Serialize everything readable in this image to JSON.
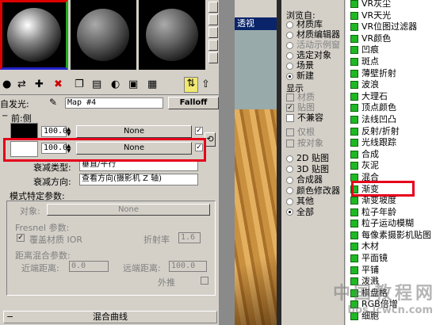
{
  "viewport_tab": "透视",
  "self_illum_label": "自发光:",
  "map_name": "Map #4",
  "falloff_label": "Falloff",
  "section_front_side": "前:侧",
  "front_value": "100.0",
  "front_map": "None",
  "side_value": "100.0",
  "side_map": "None",
  "falloff_type_label": "衰减类型:",
  "falloff_type_value": "垂直/平行",
  "falloff_dir_label": "衰减方向:",
  "falloff_dir_value": "查看方向(摄影机 Z 轴)",
  "mode_params_title": "模式特定参数:",
  "object_label": "对象:",
  "object_value": "None",
  "fresnel_label": "Fresnel 参数:",
  "override_ior_label": "覆盖材质 IOR",
  "ior_label": "折射率",
  "ior_value": "1.6",
  "distance_blend_label": "距离混合参数:",
  "near_label": "近端距离:",
  "near_value": "0.0",
  "far_label": "远端距离:",
  "far_value": "100.0",
  "extrapolate_label": "外推",
  "mix_curve_label": "混合曲线",
  "browse_from": {
    "title": "浏览自:",
    "options": [
      {
        "label": "材质库",
        "selected": false,
        "disabled": false
      },
      {
        "label": "材质编辑器",
        "selected": false,
        "disabled": false
      },
      {
        "label": "活动示例窗",
        "selected": false,
        "disabled": true
      },
      {
        "label": "选定对象",
        "selected": false,
        "disabled": false
      },
      {
        "label": "场景",
        "selected": false,
        "disabled": false
      },
      {
        "label": "新建",
        "selected": true,
        "disabled": false
      }
    ]
  },
  "show": {
    "title": "显示",
    "options": [
      {
        "label": "材质",
        "checked": false,
        "disabled": true
      },
      {
        "label": "贴图",
        "checked": true,
        "disabled": true
      },
      {
        "label": "不兼容",
        "checked": false,
        "disabled": false
      }
    ]
  },
  "filter": {
    "options": [
      {
        "label": "仅根",
        "checked": false,
        "disabled": true
      },
      {
        "label": "按对象",
        "checked": false,
        "disabled": true
      }
    ]
  },
  "map_types": {
    "options": [
      {
        "label": "2D 贴图",
        "selected": false
      },
      {
        "label": "3D 贴图",
        "selected": false
      },
      {
        "label": "合成器",
        "selected": false
      },
      {
        "label": "颜色修改器",
        "selected": false
      },
      {
        "label": "其他",
        "selected": false
      },
      {
        "label": "全部",
        "selected": true
      }
    ]
  },
  "map_list": [
    "VR灰尘",
    "VR天光",
    "VR位图过滤器",
    "VR颜色",
    "凹痕",
    "斑点",
    "薄壁折射",
    "波浪",
    "大理石",
    "顶点颜色",
    "法线凹凸",
    "反射/折射",
    "光线跟踪",
    "合成",
    "灰泥",
    "混合",
    "渐变",
    "渐变坡度",
    "粒子年龄",
    "粒子运动模糊",
    "每像素摄影机贴图",
    "木材",
    "平面镜",
    "平铺",
    "泼溅",
    "棋盘格",
    "RGB倍增",
    "细胞"
  ],
  "highlighted_item": "渐变坡度",
  "watermark_top": "中国教程网",
  "watermark_bottom": "bbs.jcwcn.com",
  "colors": {
    "accent_red": "#e5001b",
    "list_icon_green": "#1fb824",
    "titlebar_blue": "#0a246a"
  }
}
